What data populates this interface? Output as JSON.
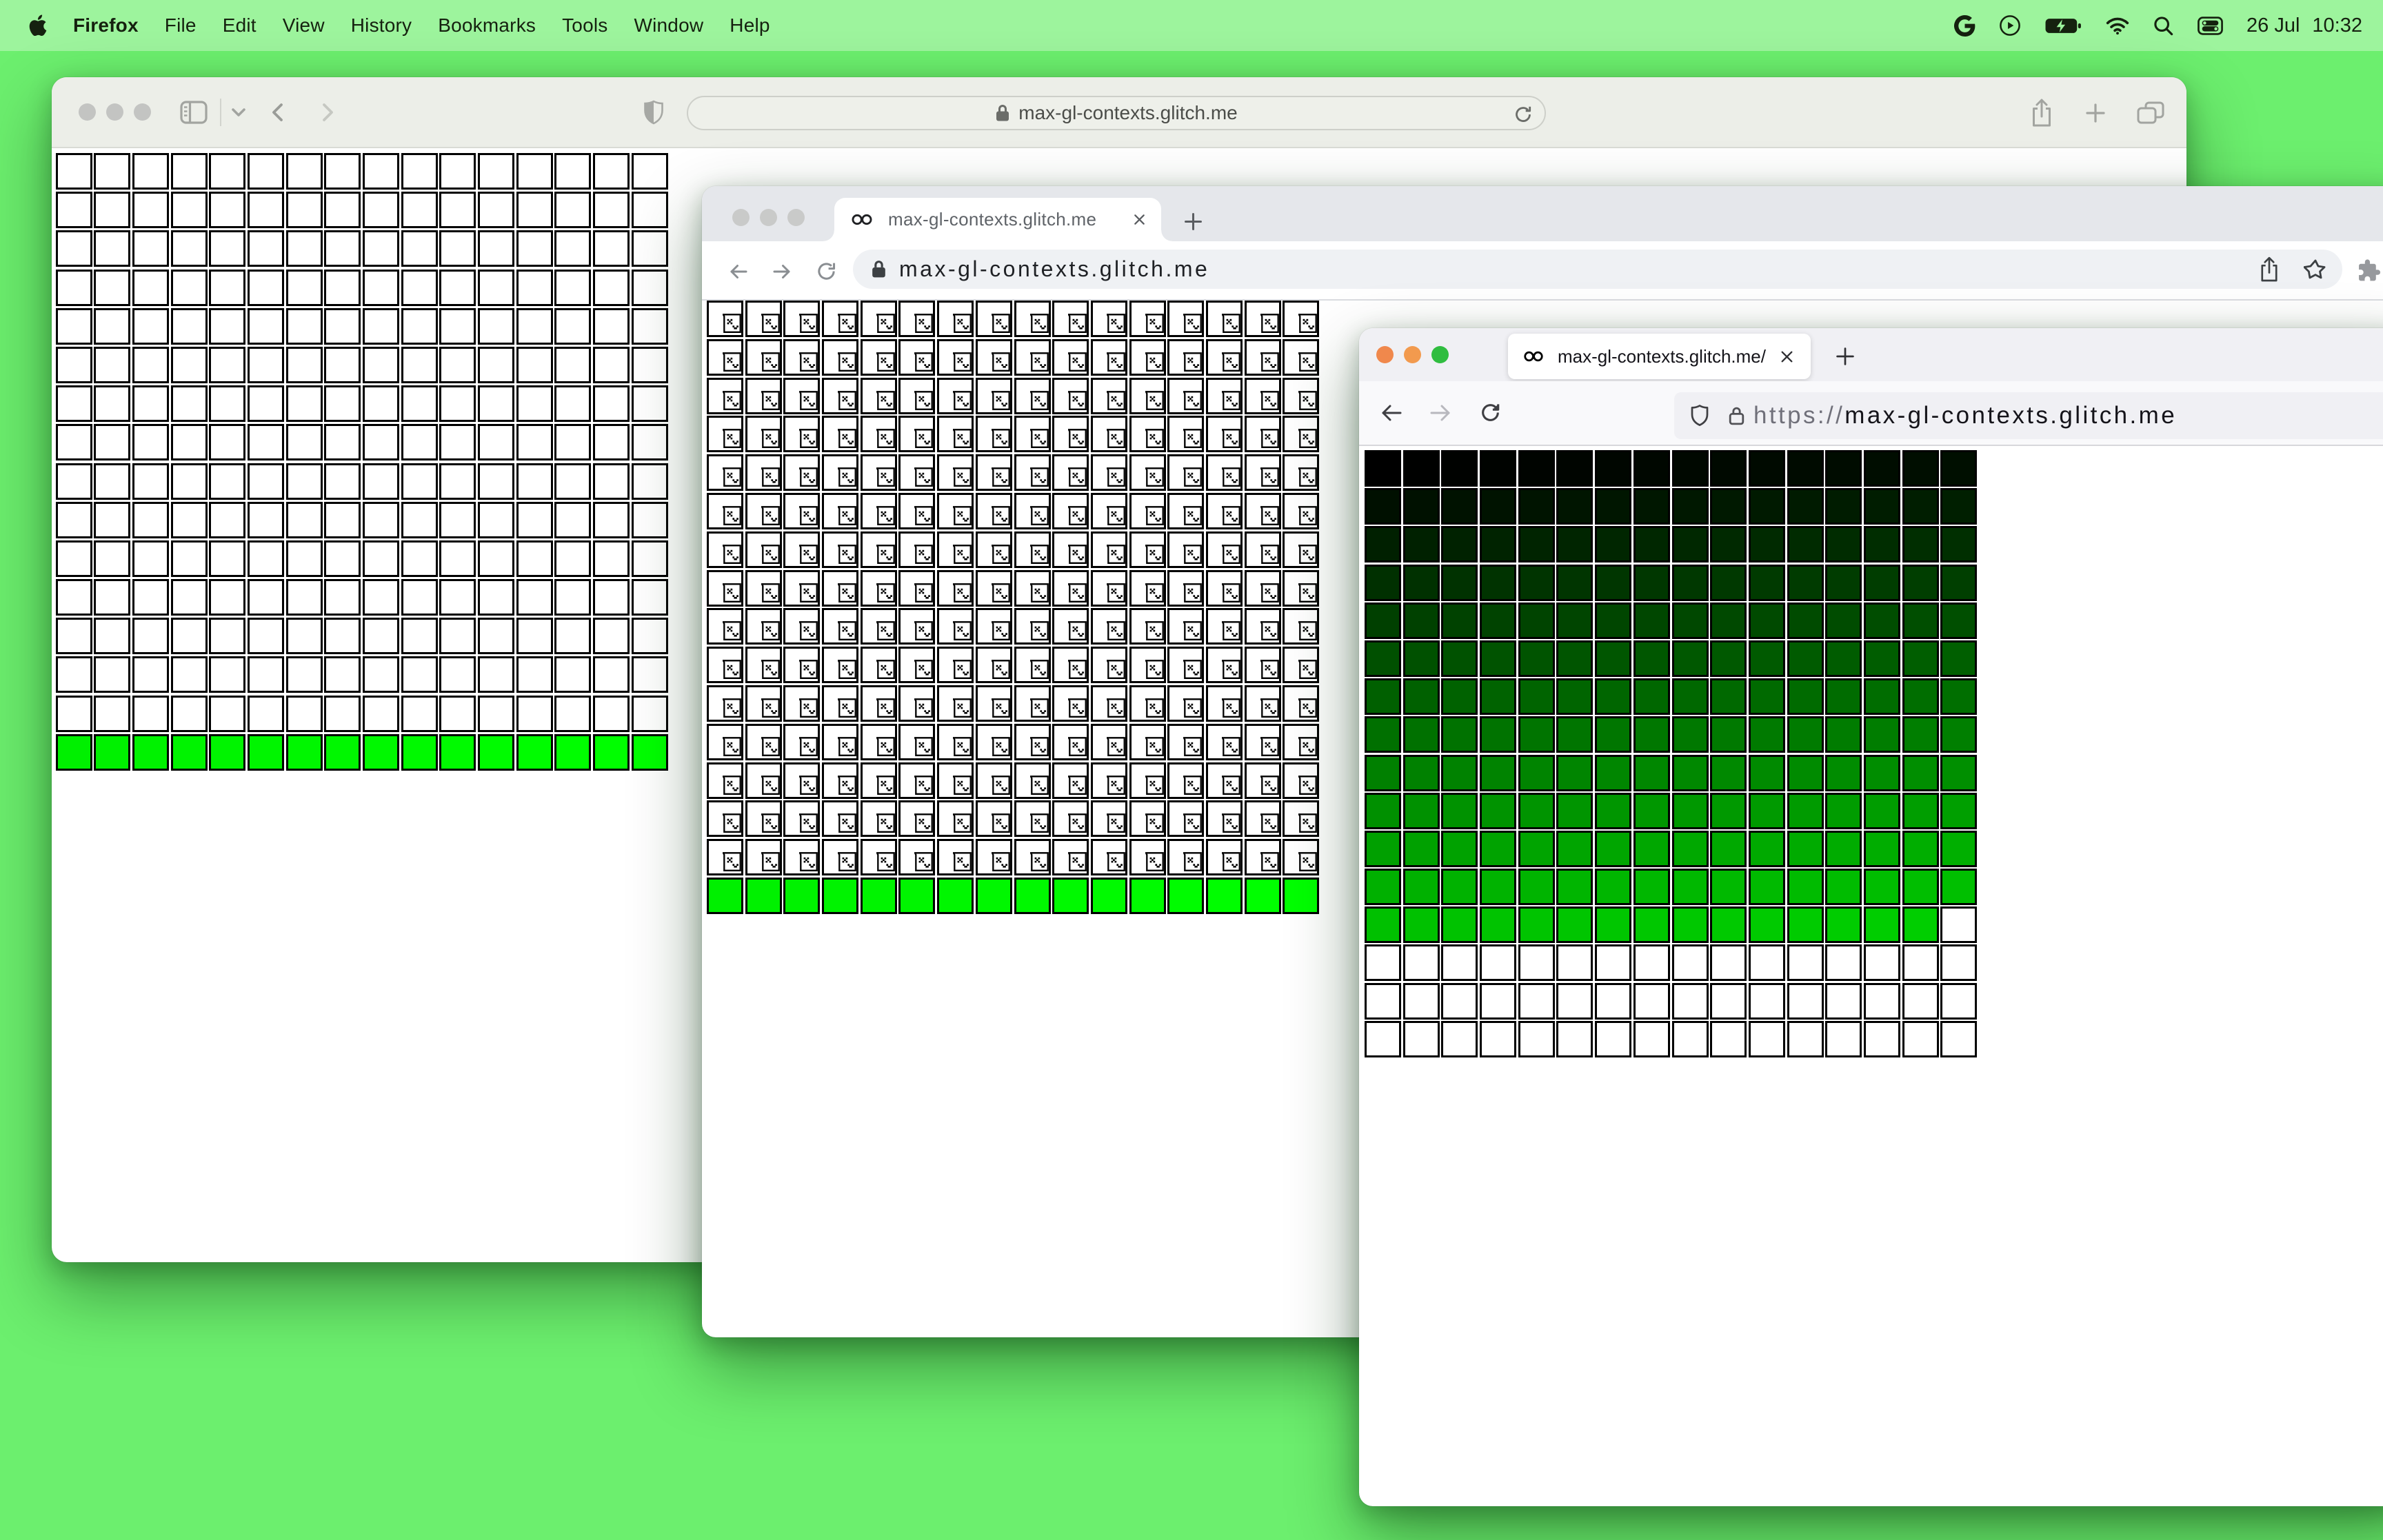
{
  "desktop": {
    "background_color": "#6cef6e",
    "menubar_color": "#9df49d"
  },
  "menubar": {
    "apple_icon": "apple-logo",
    "app_name": "Firefox",
    "items": [
      "File",
      "Edit",
      "View",
      "History",
      "Bookmarks",
      "Tools",
      "Window",
      "Help"
    ],
    "status_icons": [
      "google-g",
      "play-circle",
      "battery-charging",
      "wifi",
      "search",
      "control-center"
    ],
    "date": "26 Jul",
    "time": "10:32"
  },
  "safari": {
    "window_state": "inactive",
    "traffic_light_colors": [
      "#c3c4c2",
      "#c3c4c2",
      "#c3c4c2"
    ],
    "url": "max-gl-contexts.glitch.me",
    "toolbar_icons": [
      "sidebar",
      "chevron-down",
      "back",
      "forward",
      "privacy-shield",
      "lock",
      "reload",
      "share",
      "new-tab",
      "tab-overview"
    ]
  },
  "chrome": {
    "window_state": "inactive",
    "traffic_light_colors": [
      "#c9cac9",
      "#c9cac9",
      "#c9cac9"
    ],
    "tab_title": "max-gl-contexts.glitch.me",
    "url": "max-gl-contexts.glitch.me",
    "toolbar_icons": [
      "back",
      "forward",
      "reload",
      "lock",
      "share",
      "bookmark-star",
      "extensions"
    ]
  },
  "firefox": {
    "window_state": "active",
    "traffic_light_colors": [
      "#f0884c",
      "#f29a4e",
      "#30bd40"
    ],
    "tab_title": "max-gl-contexts.glitch.me/",
    "url_scheme": "https://",
    "url_domain": "max-gl-contexts.glitch.me",
    "toolbar_icons": [
      "back",
      "forward",
      "reload",
      "tracking-shield",
      "lock"
    ]
  },
  "grids": {
    "safari": {
      "cols": 16,
      "rows": 16,
      "white_cells": 240,
      "green_cells": 16,
      "green_range": [
        "#00f000",
        "#00ff00"
      ],
      "cells": [
        "#ffffff",
        "#ffffff",
        "#ffffff",
        "#ffffff",
        "#ffffff",
        "#ffffff",
        "#ffffff",
        "#ffffff",
        "#ffffff",
        "#ffffff",
        "#ffffff",
        "#ffffff",
        "#ffffff",
        "#ffffff",
        "#ffffff",
        "#ffffff",
        "#ffffff",
        "#ffffff",
        "#ffffff",
        "#ffffff",
        "#ffffff",
        "#ffffff",
        "#ffffff",
        "#ffffff",
        "#ffffff",
        "#ffffff",
        "#ffffff",
        "#ffffff",
        "#ffffff",
        "#ffffff",
        "#ffffff",
        "#ffffff",
        "#ffffff",
        "#ffffff",
        "#ffffff",
        "#ffffff",
        "#ffffff",
        "#ffffff",
        "#ffffff",
        "#ffffff",
        "#ffffff",
        "#ffffff",
        "#ffffff",
        "#ffffff",
        "#ffffff",
        "#ffffff",
        "#ffffff",
        "#ffffff",
        "#ffffff",
        "#ffffff",
        "#ffffff",
        "#ffffff",
        "#ffffff",
        "#ffffff",
        "#ffffff",
        "#ffffff",
        "#ffffff",
        "#ffffff",
        "#ffffff",
        "#ffffff",
        "#ffffff",
        "#ffffff",
        "#ffffff",
        "#ffffff",
        "#ffffff",
        "#ffffff",
        "#ffffff",
        "#ffffff",
        "#ffffff",
        "#ffffff",
        "#ffffff",
        "#ffffff",
        "#ffffff",
        "#ffffff",
        "#ffffff",
        "#ffffff",
        "#ffffff",
        "#ffffff",
        "#ffffff",
        "#ffffff",
        "#ffffff",
        "#ffffff",
        "#ffffff",
        "#ffffff",
        "#ffffff",
        "#ffffff",
        "#ffffff",
        "#ffffff",
        "#ffffff",
        "#ffffff",
        "#ffffff",
        "#ffffff",
        "#ffffff",
        "#ffffff",
        "#ffffff",
        "#ffffff",
        "#ffffff",
        "#ffffff",
        "#ffffff",
        "#ffffff",
        "#ffffff",
        "#ffffff",
        "#ffffff",
        "#ffffff",
        "#ffffff",
        "#ffffff",
        "#ffffff",
        "#ffffff",
        "#ffffff",
        "#ffffff",
        "#ffffff",
        "#ffffff",
        "#ffffff",
        "#ffffff",
        "#ffffff",
        "#ffffff",
        "#ffffff",
        "#ffffff",
        "#ffffff",
        "#ffffff",
        "#ffffff",
        "#ffffff",
        "#ffffff",
        "#ffffff",
        "#ffffff",
        "#ffffff",
        "#ffffff",
        "#ffffff",
        "#ffffff",
        "#ffffff",
        "#ffffff",
        "#ffffff",
        "#ffffff",
        "#ffffff",
        "#ffffff",
        "#ffffff",
        "#ffffff",
        "#ffffff",
        "#ffffff",
        "#ffffff",
        "#ffffff",
        "#ffffff",
        "#ffffff",
        "#ffffff",
        "#ffffff",
        "#ffffff",
        "#ffffff",
        "#ffffff",
        "#ffffff",
        "#ffffff",
        "#ffffff",
        "#ffffff",
        "#ffffff",
        "#ffffff",
        "#ffffff",
        "#ffffff",
        "#ffffff",
        "#ffffff",
        "#ffffff",
        "#ffffff",
        "#ffffff",
        "#ffffff",
        "#ffffff",
        "#ffffff",
        "#ffffff",
        "#ffffff",
        "#ffffff",
        "#ffffff",
        "#ffffff",
        "#ffffff",
        "#ffffff",
        "#ffffff",
        "#ffffff",
        "#ffffff",
        "#ffffff",
        "#ffffff",
        "#ffffff",
        "#ffffff",
        "#ffffff",
        "#ffffff",
        "#ffffff",
        "#ffffff",
        "#ffffff",
        "#ffffff",
        "#ffffff",
        "#ffffff",
        "#ffffff",
        "#ffffff",
        "#ffffff",
        "#ffffff",
        "#ffffff",
        "#ffffff",
        "#ffffff",
        "#ffffff",
        "#ffffff",
        "#ffffff",
        "#ffffff",
        "#ffffff",
        "#ffffff",
        "#ffffff",
        "#ffffff",
        "#ffffff",
        "#ffffff",
        "#ffffff",
        "#ffffff",
        "#ffffff",
        "#ffffff",
        "#ffffff",
        "#ffffff",
        "#ffffff",
        "#ffffff",
        "#ffffff",
        "#ffffff",
        "#ffffff",
        "#ffffff",
        "#ffffff",
        "#ffffff",
        "#ffffff",
        "#ffffff",
        "#ffffff",
        "#ffffff",
        "#ffffff",
        "#ffffff",
        "#ffffff",
        "#ffffff",
        "#ffffff",
        "#ffffff",
        "#ffffff",
        "#ffffff",
        "#ffffff",
        "#ffffff",
        "#ffffff",
        "#ffffff",
        "#ffffff",
        "#ffffff",
        "#ffffff",
        "#ffffff",
        "#ffffff",
        "#ffffff",
        "#ffffff",
        "#00f000",
        "#00f100",
        "#00f200",
        "#00f300",
        "#00f400",
        "#00f500",
        "#00f600",
        "#00f700",
        "#00f800",
        "#00f900",
        "#00fa00",
        "#00fb00",
        "#00fc00",
        "#00fd00",
        "#00fe00",
        "#00ff00"
      ]
    },
    "chrome": {
      "cols": 16,
      "rows": 16,
      "broken_cells": 240,
      "green_cells": 16,
      "green_range": [
        "#00f000",
        "#00ff00"
      ],
      "cells": [
        "broken",
        "broken",
        "broken",
        "broken",
        "broken",
        "broken",
        "broken",
        "broken",
        "broken",
        "broken",
        "broken",
        "broken",
        "broken",
        "broken",
        "broken",
        "broken",
        "broken",
        "broken",
        "broken",
        "broken",
        "broken",
        "broken",
        "broken",
        "broken",
        "broken",
        "broken",
        "broken",
        "broken",
        "broken",
        "broken",
        "broken",
        "broken",
        "broken",
        "broken",
        "broken",
        "broken",
        "broken",
        "broken",
        "broken",
        "broken",
        "broken",
        "broken",
        "broken",
        "broken",
        "broken",
        "broken",
        "broken",
        "broken",
        "broken",
        "broken",
        "broken",
        "broken",
        "broken",
        "broken",
        "broken",
        "broken",
        "broken",
        "broken",
        "broken",
        "broken",
        "broken",
        "broken",
        "broken",
        "broken",
        "broken",
        "broken",
        "broken",
        "broken",
        "broken",
        "broken",
        "broken",
        "broken",
        "broken",
        "broken",
        "broken",
        "broken",
        "broken",
        "broken",
        "broken",
        "broken",
        "broken",
        "broken",
        "broken",
        "broken",
        "broken",
        "broken",
        "broken",
        "broken",
        "broken",
        "broken",
        "broken",
        "broken",
        "broken",
        "broken",
        "broken",
        "broken",
        "broken",
        "broken",
        "broken",
        "broken",
        "broken",
        "broken",
        "broken",
        "broken",
        "broken",
        "broken",
        "broken",
        "broken",
        "broken",
        "broken",
        "broken",
        "broken",
        "broken",
        "broken",
        "broken",
        "broken",
        "broken",
        "broken",
        "broken",
        "broken",
        "broken",
        "broken",
        "broken",
        "broken",
        "broken",
        "broken",
        "broken",
        "broken",
        "broken",
        "broken",
        "broken",
        "broken",
        "broken",
        "broken",
        "broken",
        "broken",
        "broken",
        "broken",
        "broken",
        "broken",
        "broken",
        "broken",
        "broken",
        "broken",
        "broken",
        "broken",
        "broken",
        "broken",
        "broken",
        "broken",
        "broken",
        "broken",
        "broken",
        "broken",
        "broken",
        "broken",
        "broken",
        "broken",
        "broken",
        "broken",
        "broken",
        "broken",
        "broken",
        "broken",
        "broken",
        "broken",
        "broken",
        "broken",
        "broken",
        "broken",
        "broken",
        "broken",
        "broken",
        "broken",
        "broken",
        "broken",
        "broken",
        "broken",
        "broken",
        "broken",
        "broken",
        "broken",
        "broken",
        "broken",
        "broken",
        "broken",
        "broken",
        "broken",
        "broken",
        "broken",
        "broken",
        "broken",
        "broken",
        "broken",
        "broken",
        "broken",
        "broken",
        "broken",
        "broken",
        "broken",
        "broken",
        "broken",
        "broken",
        "broken",
        "broken",
        "broken",
        "broken",
        "broken",
        "broken",
        "broken",
        "broken",
        "broken",
        "broken",
        "broken",
        "broken",
        "broken",
        "broken",
        "broken",
        "broken",
        "broken",
        "broken",
        "broken",
        "broken",
        "broken",
        "broken",
        "broken",
        "broken",
        "broken",
        "broken",
        "broken",
        "broken",
        "broken",
        "broken",
        "broken",
        "broken",
        "broken",
        "broken",
        "broken",
        "broken",
        "broken",
        "#00f000",
        "#00f100",
        "#00f200",
        "#00f300",
        "#00f400",
        "#00f500",
        "#00f600",
        "#00f700",
        "#00f800",
        "#00f900",
        "#00fa00",
        "#00fb00",
        "#00fc00",
        "#00fd00",
        "#00fe00",
        "#00ff00"
      ]
    },
    "firefox": {
      "cols": 16,
      "rows": 16,
      "colored_cells": 207,
      "white_cells": 49,
      "gradient": "rgb(0, index, 0)",
      "cells": [
        "#000000",
        "#000100",
        "#000200",
        "#000300",
        "#000400",
        "#000500",
        "#000600",
        "#000700",
        "#000800",
        "#000900",
        "#000a00",
        "#000b00",
        "#000c00",
        "#000d00",
        "#000e00",
        "#000f00",
        "#001000",
        "#001100",
        "#001200",
        "#001300",
        "#001400",
        "#001500",
        "#001600",
        "#001700",
        "#001800",
        "#001900",
        "#001a00",
        "#001b00",
        "#001c00",
        "#001d00",
        "#001e00",
        "#001f00",
        "#002000",
        "#002100",
        "#002200",
        "#002300",
        "#002400",
        "#002500",
        "#002600",
        "#002700",
        "#002800",
        "#002900",
        "#002a00",
        "#002b00",
        "#002c00",
        "#002d00",
        "#002e00",
        "#002f00",
        "#003000",
        "#003100",
        "#003200",
        "#003300",
        "#003400",
        "#003500",
        "#003600",
        "#003700",
        "#003800",
        "#003900",
        "#003a00",
        "#003b00",
        "#003c00",
        "#003d00",
        "#003e00",
        "#003f00",
        "#004000",
        "#004100",
        "#004200",
        "#004300",
        "#004400",
        "#004500",
        "#004600",
        "#004700",
        "#004800",
        "#004900",
        "#004a00",
        "#004b00",
        "#004c00",
        "#004d00",
        "#004e00",
        "#004f00",
        "#005000",
        "#005100",
        "#005200",
        "#005300",
        "#005400",
        "#005500",
        "#005600",
        "#005700",
        "#005800",
        "#005900",
        "#005a00",
        "#005b00",
        "#005c00",
        "#005d00",
        "#005e00",
        "#005f00",
        "#006000",
        "#006100",
        "#006200",
        "#006300",
        "#006400",
        "#006500",
        "#006600",
        "#006700",
        "#006800",
        "#006900",
        "#006a00",
        "#006b00",
        "#006c00",
        "#006d00",
        "#006e00",
        "#006f00",
        "#007000",
        "#007100",
        "#007200",
        "#007300",
        "#007400",
        "#007500",
        "#007600",
        "#007700",
        "#007800",
        "#007900",
        "#007a00",
        "#007b00",
        "#007c00",
        "#007d00",
        "#007e00",
        "#007f00",
        "#008000",
        "#008100",
        "#008200",
        "#008300",
        "#008400",
        "#008500",
        "#008600",
        "#008700",
        "#008800",
        "#008900",
        "#008a00",
        "#008b00",
        "#008c00",
        "#008d00",
        "#008e00",
        "#008f00",
        "#009000",
        "#009100",
        "#009200",
        "#009300",
        "#009400",
        "#009500",
        "#009600",
        "#009700",
        "#009800",
        "#009900",
        "#009a00",
        "#009b00",
        "#009c00",
        "#009d00",
        "#009e00",
        "#009f00",
        "#00a000",
        "#00a100",
        "#00a200",
        "#00a300",
        "#00a400",
        "#00a500",
        "#00a600",
        "#00a700",
        "#00a800",
        "#00a900",
        "#00aa00",
        "#00ab00",
        "#00ac00",
        "#00ad00",
        "#00ae00",
        "#00af00",
        "#00b000",
        "#00b100",
        "#00b200",
        "#00b300",
        "#00b400",
        "#00b500",
        "#00b600",
        "#00b700",
        "#00b800",
        "#00b900",
        "#00ba00",
        "#00bb00",
        "#00bc00",
        "#00bd00",
        "#00be00",
        "#00bf00",
        "#00c000",
        "#00c100",
        "#00c200",
        "#00c300",
        "#00c400",
        "#00c500",
        "#00c600",
        "#00c700",
        "#00c800",
        "#00c900",
        "#00ca00",
        "#00cb00",
        "#00cc00",
        "#00cd00",
        "#00ce00",
        "#ffffff",
        "#ffffff",
        "#ffffff",
        "#ffffff",
        "#ffffff",
        "#ffffff",
        "#ffffff",
        "#ffffff",
        "#ffffff",
        "#ffffff",
        "#ffffff",
        "#ffffff",
        "#ffffff",
        "#ffffff",
        "#ffffff",
        "#ffffff",
        "#ffffff",
        "#ffffff",
        "#ffffff",
        "#ffffff",
        "#ffffff",
        "#ffffff",
        "#ffffff",
        "#ffffff",
        "#ffffff",
        "#ffffff",
        "#ffffff",
        "#ffffff",
        "#ffffff",
        "#ffffff",
        "#ffffff",
        "#ffffff",
        "#ffffff",
        "#ffffff",
        "#ffffff",
        "#ffffff",
        "#ffffff",
        "#ffffff",
        "#ffffff",
        "#ffffff",
        "#ffffff",
        "#ffffff",
        "#ffffff",
        "#ffffff",
        "#ffffff",
        "#ffffff",
        "#ffffff",
        "#ffffff",
        "#ffffff"
      ]
    }
  }
}
